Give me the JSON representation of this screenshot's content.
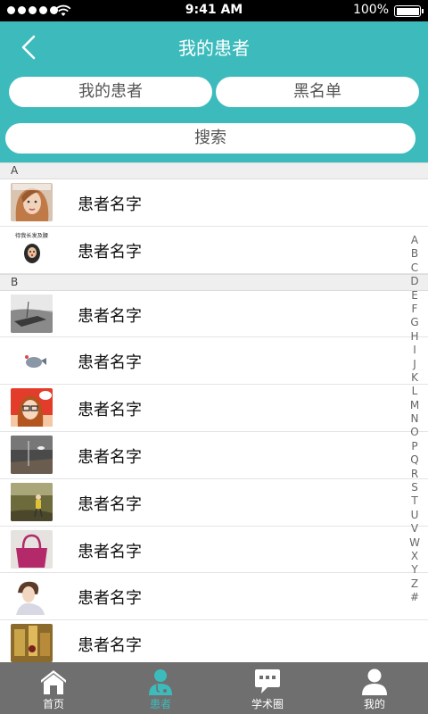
{
  "status_bar": {
    "time": "9:41 AM",
    "battery": "100%"
  },
  "header": {
    "title": "我的患者",
    "segments": [
      "我的患者",
      "黑名单"
    ],
    "search_placeholder": "搜索"
  },
  "list": {
    "sections": [
      {
        "letter": "A",
        "patients": [
          "患者名字",
          "患者名字"
        ]
      },
      {
        "letter": "B",
        "patients": [
          "患者名字",
          "患者名字",
          "患者名字",
          "患者名字",
          "患者名字",
          "患者名字",
          "患者名字",
          "患者名字"
        ]
      }
    ]
  },
  "avatar_sticker_text": "待我长发及腰",
  "index_bar": [
    "A",
    "B",
    "C",
    "D",
    "E",
    "F",
    "G",
    "H",
    "I",
    "J",
    "K",
    "L",
    "M",
    "N",
    "O",
    "P",
    "Q",
    "R",
    "S",
    "T",
    "U",
    "V",
    "W",
    "X",
    "Y",
    "Z",
    "#"
  ],
  "tab_bar": {
    "tabs": [
      {
        "label": "首页",
        "icon": "home-icon"
      },
      {
        "label": "患者",
        "icon": "patient-icon",
        "active": true
      },
      {
        "label": "学术圈",
        "icon": "chat-icon"
      },
      {
        "label": "我的",
        "icon": "profile-icon"
      }
    ]
  },
  "colors": {
    "accent": "#3dbbbc",
    "tab_bar": "#6f6f6f",
    "section_bg": "#efefef"
  }
}
